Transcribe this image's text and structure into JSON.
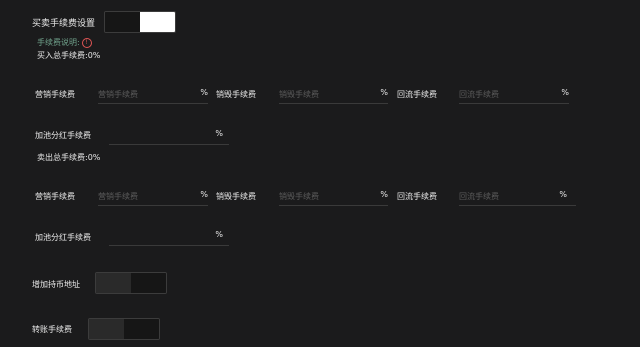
{
  "fee_settings": {
    "title": "买卖手续费设置",
    "explain_label": "手续费说明:",
    "buy_total_label": "买入总手续费:",
    "buy_total_value": "0%",
    "sell_total_label": "卖出总手续费:",
    "sell_total_value": "0%"
  },
  "buy": {
    "marketing_label": "营销手续费",
    "marketing_placeholder": "营销手续费",
    "burn_label": "销毁手续费",
    "burn_placeholder": "销毁手续费",
    "reflow_label": "回流手续费",
    "reflow_placeholder": "回流手续费",
    "dividend_label": "加池分红手续费",
    "percent": "%"
  },
  "sell": {
    "marketing_label": "营销手续费",
    "marketing_placeholder": "营销手续费",
    "burn_label": "销毁手续费",
    "burn_placeholder": "销毁手续费",
    "reflow_label": "回流手续费",
    "reflow_placeholder": "回流手续费",
    "dividend_label": "加池分红手续费",
    "percent": "%"
  },
  "add_holder": {
    "label": "增加持币地址"
  },
  "transfer_fee": {
    "label": "转账手续费"
  },
  "colors": {
    "background": "#1b1b1c",
    "toggle_on": "#ffffff",
    "warning": "#e05555"
  },
  "icons": {
    "explain": "warning-circle-icon"
  }
}
